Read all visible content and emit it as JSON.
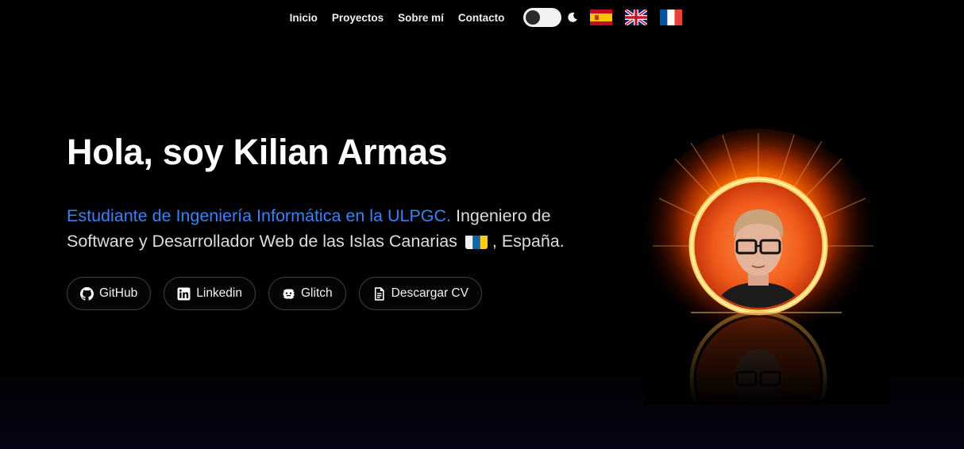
{
  "nav": {
    "links": [
      "Inicio",
      "Proyectos",
      "Sobre mí",
      "Contacto"
    ],
    "theme_toggle": {
      "icon": "moon-icon",
      "state": "dark"
    },
    "flags": [
      {
        "lang": "es",
        "icon": "spain-flag-icon"
      },
      {
        "lang": "en",
        "icon": "uk-flag-icon"
      },
      {
        "lang": "fr",
        "icon": "france-flag-icon"
      }
    ]
  },
  "hero": {
    "title": "Hola, soy Kilian Armas",
    "highlight": "Estudiante de Ingeniería Informática en la ULPGC.",
    "description_part1": " Ingeniero de Software y Desarrollador Web de las Islas Canarias ",
    "description_part2": " , España.",
    "region_flag_icon": "canary-islands-flag-icon"
  },
  "buttons": [
    {
      "label": "GitHub",
      "icon": "github-icon"
    },
    {
      "label": "Linkedin",
      "icon": "linkedin-icon"
    },
    {
      "label": "Glitch",
      "icon": "glitch-icon"
    },
    {
      "label": "Descargar CV",
      "icon": "document-icon"
    }
  ],
  "colors": {
    "background": "#000000",
    "accent": "#3b82f6",
    "text": "#dcdcdc",
    "button_border": "#3f3f3f",
    "portal_fire": "#ff7a18"
  },
  "portrait": {
    "description_icon": "fire-portal-avatar"
  }
}
